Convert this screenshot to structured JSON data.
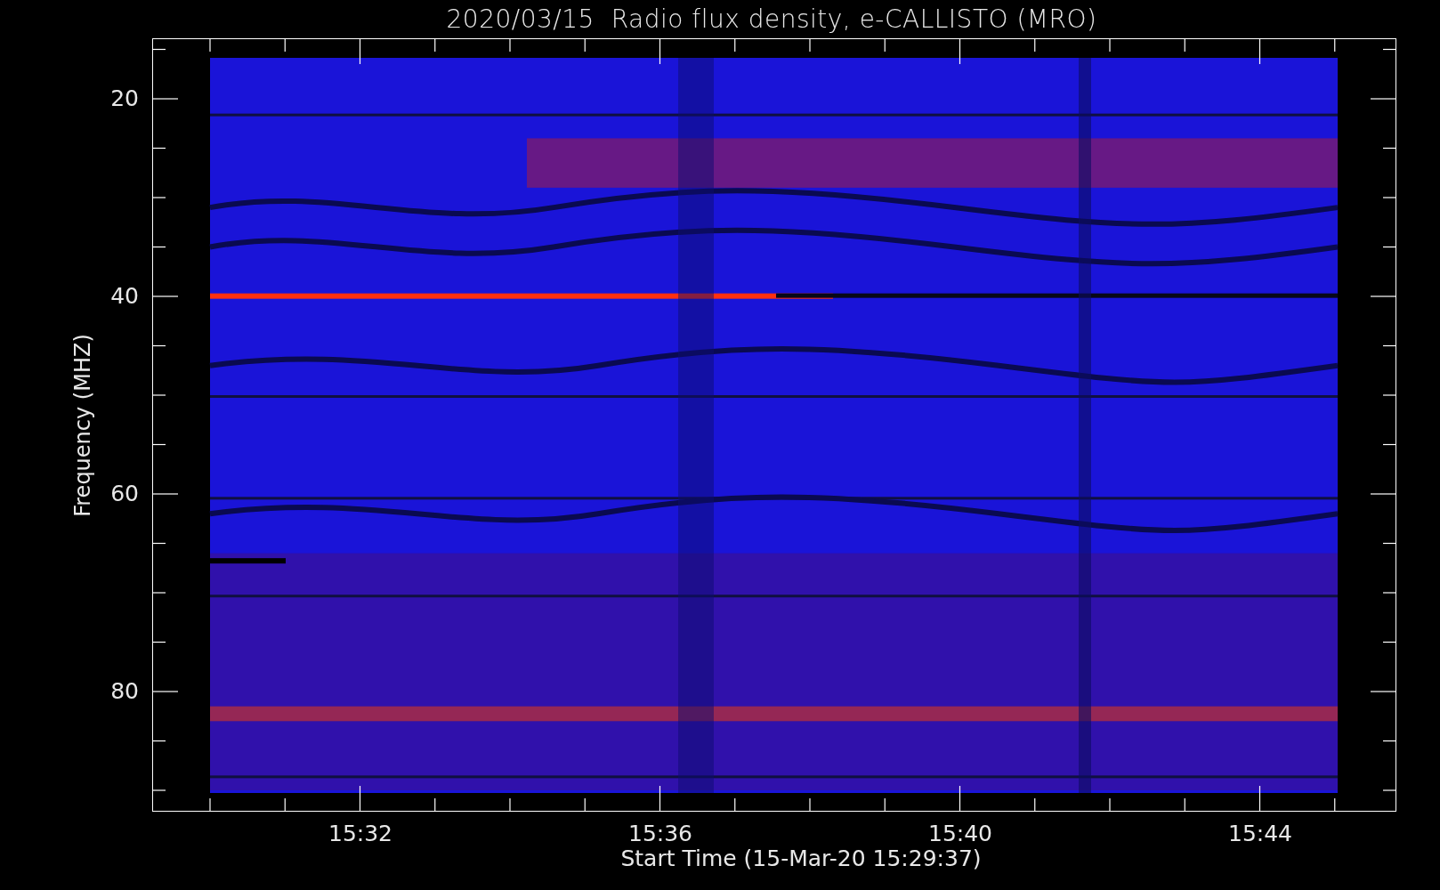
{
  "title": "2020/03/15  Radio flux density, e-CALLISTO (MRO)",
  "y_axis": {
    "label": "Frequency (MHZ)",
    "ticks": [
      "20",
      "40",
      "60",
      "80"
    ]
  },
  "x_axis": {
    "label": "Start Time (15-Mar-20 15:29:37)",
    "ticks": [
      "15:32",
      "15:36",
      "15:40",
      "15:44"
    ]
  }
}
